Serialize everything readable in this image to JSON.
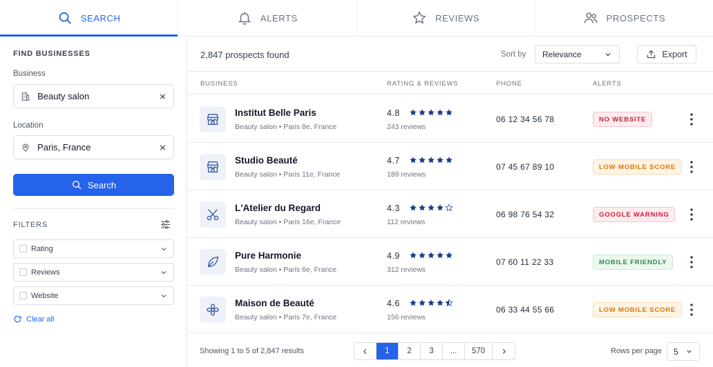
{
  "tabs": [
    {
      "label": "SEARCH",
      "icon": "search-icon"
    },
    {
      "label": "ALERTS",
      "icon": "bell-icon"
    },
    {
      "label": "REVIEWS",
      "icon": "star-icon"
    },
    {
      "label": "PROSPECTS",
      "icon": "users-icon"
    }
  ],
  "sidebar": {
    "find_title": "FIND BUSINESSES",
    "business_label": "Business",
    "business_value": "Beauty salon",
    "location_label": "Location",
    "location_value": "Paris, France",
    "search_label": "Search",
    "filters_title": "FILTERS",
    "filters": [
      "Rating",
      "Reviews",
      "Website"
    ],
    "clear_all": "Clear all"
  },
  "toolbar": {
    "count": "2,847 prospects found",
    "sort_label": "Sort by",
    "sort_value": "Relevance",
    "export_label": "Export"
  },
  "table": {
    "headers": [
      "BUSINESS",
      "RATING & REVIEWS",
      "PHONE",
      "ALERTS"
    ],
    "rows": [
      {
        "name": "Institut Belle Paris",
        "meta": "Beauty salon • Paris 8e, France",
        "rating": "4.8",
        "stars": 5,
        "reviews": "243 reviews",
        "phone": "06 12 34 56 78",
        "alert": "NO WEBSITE",
        "alert_type": "red",
        "icon": "storefront-icon"
      },
      {
        "name": "Studio Beauté",
        "meta": "Beauty salon • Paris 11e, France",
        "rating": "4.7",
        "stars": 5,
        "reviews": "189 reviews",
        "phone": "07 45 67 89 10",
        "alert": "LOW MOBILE SCORE",
        "alert_type": "orange",
        "icon": "storefront-icon"
      },
      {
        "name": "L'Atelier du Regard",
        "meta": "Beauty salon • Paris 16e, France",
        "rating": "4.3",
        "stars": 4,
        "reviews": "112 reviews",
        "phone": "06 98 76 54 32",
        "alert": "GOOGLE WARNING",
        "alert_type": "red",
        "icon": "scissors-icon"
      },
      {
        "name": "Pure Harmonie",
        "meta": "Beauty salon • Paris 6e, France",
        "rating": "4.9",
        "stars": 5,
        "reviews": "312 reviews",
        "phone": "07 60 11 22 33",
        "alert": "MOBILE FRIENDLY",
        "alert_type": "green",
        "icon": "leaf-icon"
      },
      {
        "name": "Maison de Beauté",
        "meta": "Beauty salon • Paris 7e, France",
        "rating": "4.6",
        "stars": 4.5,
        "reviews": "156 reviews",
        "phone": "06 33 44 55 66",
        "alert": "LOW MOBILE SCORE",
        "alert_type": "orange",
        "icon": "flower-icon"
      }
    ]
  },
  "footer": {
    "showing": "Showing 1 to 5 of 2,847 results",
    "pages": [
      "1",
      "2",
      "3",
      "...",
      "570"
    ],
    "rows_per_page_label": "Rows per page",
    "rows_per_page_value": "5"
  },
  "colors": {
    "accent": "#2563eb",
    "star": "#1e3a8a",
    "badge_red_bg": "#fdecee",
    "badge_red_fg": "#c81e3a",
    "badge_red_border": "#f6c6cd",
    "badge_orange_bg": "#fff4e5",
    "badge_orange_fg": "#d97706",
    "badge_orange_border": "#fbdcb0",
    "badge_green_bg": "#ecf8ef",
    "badge_green_fg": "#2f8a46",
    "badge_green_border": "#c8e9d1"
  }
}
